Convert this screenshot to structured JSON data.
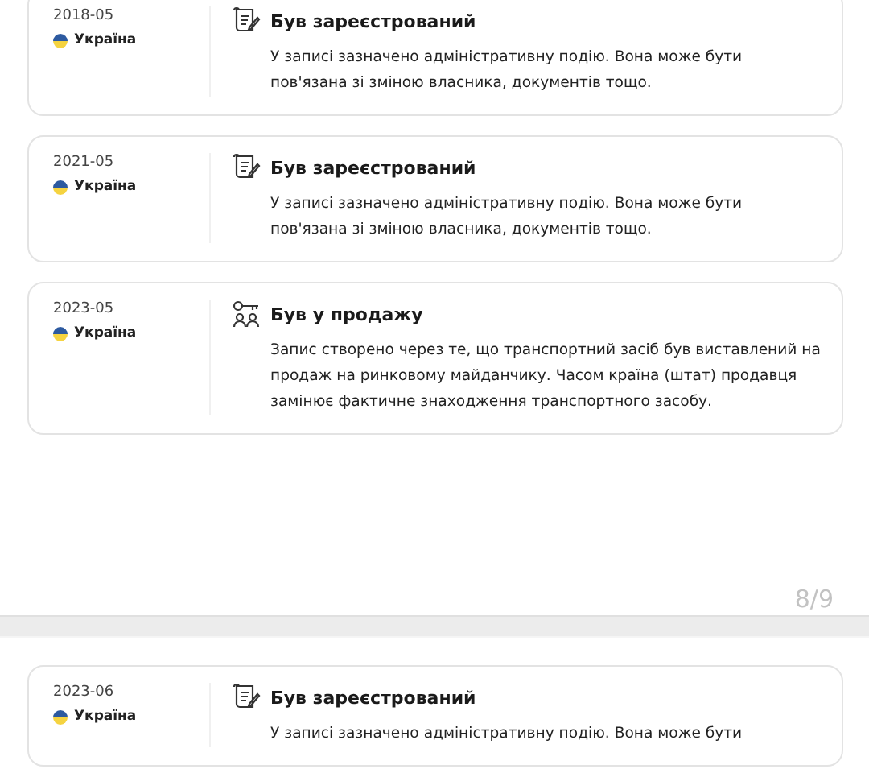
{
  "groups": [
    {
      "events": [
        {
          "date": "2018-05",
          "country": "Україна",
          "kind": "registered",
          "title": "Був зареєстрований",
          "text": "У записі зазначено адміністративну подію. Вона може бути пов'язана зі зміною власника, документів тощо."
        },
        {
          "date": "2021-05",
          "country": "Україна",
          "kind": "registered",
          "title": "Був зареєстрований",
          "text": "У записі зазначено адміністративну подію. Вона може бути пов'язана зі зміною власника, документів тощо."
        },
        {
          "date": "2023-05",
          "country": "Україна",
          "kind": "sale",
          "title": "Був у продажу",
          "text": "Запис створено через те, що транспортний засіб був виставлений на продаж на ринковому майданчику. Часом країна (штат) продавця замінює фактичне знаходження транспортного засобу."
        }
      ],
      "pager": "8/9"
    },
    {
      "events": [
        {
          "date": "2023-06",
          "country": "Україна",
          "kind": "registered",
          "title": "Був зареєстрований",
          "text": "У записі зазначено адміністративну подію. Вона може бути"
        }
      ]
    }
  ]
}
